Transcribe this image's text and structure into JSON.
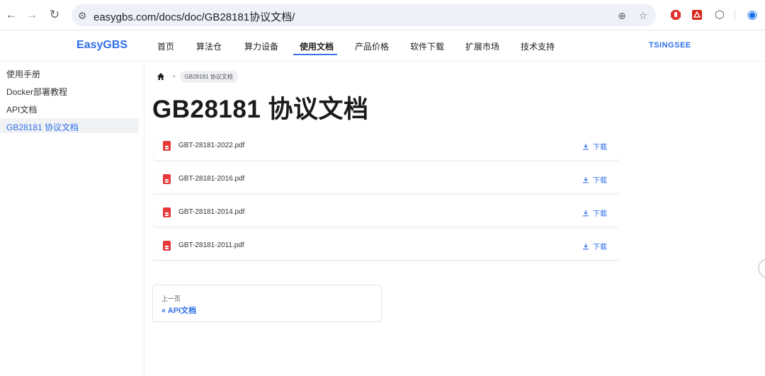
{
  "browser": {
    "url": "easygbs.com/docs/doc/GB28181协议文档/",
    "back_icon": "←",
    "forward_icon": "→",
    "reload_icon": "↻",
    "site_info_icon": "⚙",
    "zoom_icon": "⊕",
    "star_icon": "☆",
    "extensions_icon": "⬡",
    "profile_icon": "◉"
  },
  "nav": {
    "logo": "EasyGBS",
    "items": [
      "首页",
      "算法仓",
      "算力设备",
      "使用文档",
      "产品价格",
      "软件下载",
      "扩展市场",
      "技术支持"
    ],
    "active_index": 3,
    "brand_right": "TSINGSEE"
  },
  "sidebar": {
    "items": [
      "使用手册",
      "Docker部署教程",
      "API文档",
      "GB28181 协议文档"
    ],
    "active_index": 3
  },
  "breadcrumb": {
    "current": "GB28181 协议文档"
  },
  "page": {
    "title": "GB28181 协议文档"
  },
  "files": [
    {
      "name": "GBT-28181-2022.pdf",
      "action": "下载"
    },
    {
      "name": "GBT-28181-2016.pdf",
      "action": "下载"
    },
    {
      "name": "GBT-28181-2014.pdf",
      "action": "下载"
    },
    {
      "name": "GBT-28181-2011.pdf",
      "action": "下载"
    }
  ],
  "pagination": {
    "prev_label": "上一页",
    "prev_link": "« API文档"
  },
  "colors": {
    "accent": "#2f6fea",
    "pdf": "#e5393a"
  }
}
